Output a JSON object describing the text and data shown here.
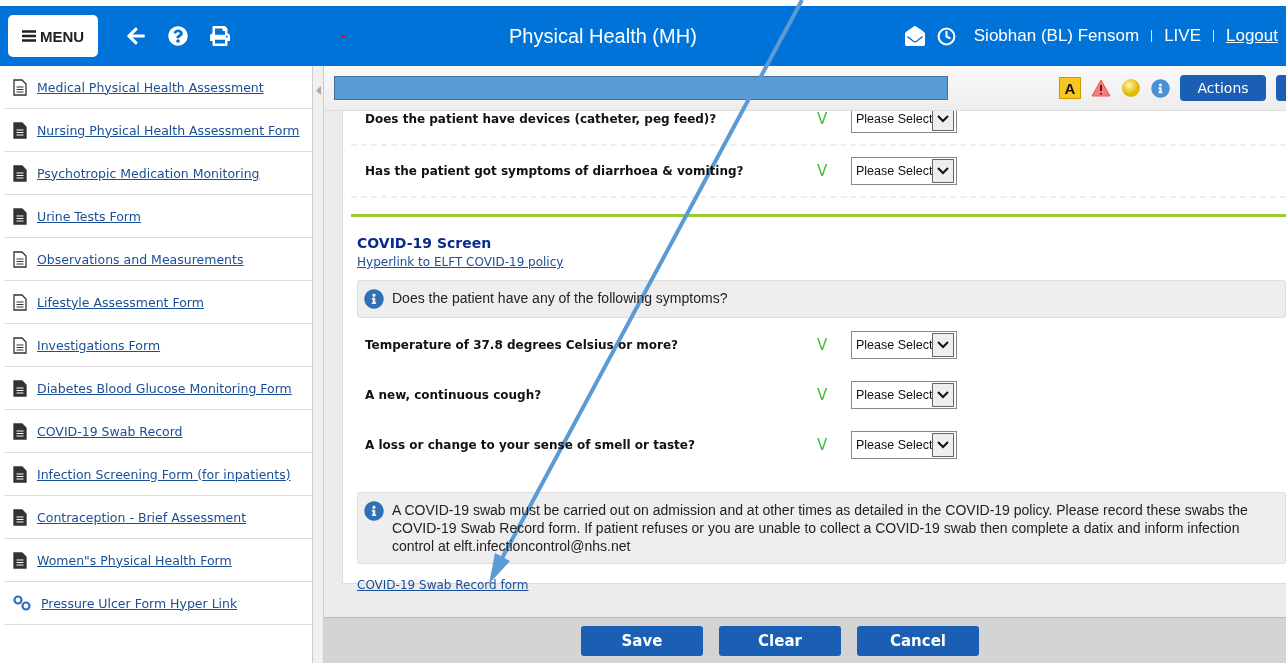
{
  "header": {
    "menu_label": "MENU",
    "title": "Physical Health (MH)",
    "user": "Siobhan (BL) Fensom",
    "environment": "LIVE",
    "logout": "Logout"
  },
  "sidebar": {
    "items": [
      {
        "label": "Medical Physical Health Assessment",
        "kind": "outline"
      },
      {
        "label": "Nursing Physical Health Assessment Form",
        "kind": "filled"
      },
      {
        "label": "Psychotropic Medication Monitoring",
        "kind": "filled"
      },
      {
        "label": "Urine Tests Form",
        "kind": "filled"
      },
      {
        "label": "Observations and Measurements",
        "kind": "outline"
      },
      {
        "label": "Lifestyle Assessment Form",
        "kind": "outline"
      },
      {
        "label": "Investigations Form",
        "kind": "outline"
      },
      {
        "label": "Diabetes Blood Glucose Monitoring Form",
        "kind": "filled"
      },
      {
        "label": "COVID-19 Swab Record",
        "kind": "filled"
      },
      {
        "label": "Infection Screening Form (for inpatients)",
        "kind": "filled"
      },
      {
        "label": "Contraception - Brief Assessment",
        "kind": "filled"
      },
      {
        "label": "Women\"s Physical Health Form",
        "kind": "filled"
      },
      {
        "label": "Pressure Ulcer Form Hyper Link",
        "kind": "link"
      }
    ]
  },
  "toolbar": {
    "badge_letter": "A",
    "actions": "Actions"
  },
  "questions": [
    {
      "text": "Does the patient have devices (catheter, peg feed)?",
      "marker": "V",
      "value": "Please Select"
    },
    {
      "text": "Has the patient got symptoms of diarrhoea & vomiting?",
      "marker": "V",
      "value": "Please Select"
    }
  ],
  "covid": {
    "title": "COVID-19 Screen",
    "policy_link": "Hyperlink to ELFT COVID-19 policy",
    "info": "Does the patient have any of the following symptoms?",
    "questions": [
      {
        "text": "Temperature of 37.8 degrees Celsius or more?",
        "marker": "V",
        "value": "Please Select"
      },
      {
        "text": "A new, continuous cough?",
        "marker": "V",
        "value": "Please Select"
      },
      {
        "text": "A loss or change to your sense of smell or taste?",
        "marker": "V",
        "value": "Please Select"
      }
    ],
    "notice": "A COVID-19 swab must be carried out on admission and at other times as detailed in the COVID-19 policy. Please record these swabs the COVID-19 Swab Record form. If patient refuses or you are unable to collect a COVID-19 swab then complete a datix and inform infection control at elft.infectioncontrol@nhs.net",
    "form_link": "COVID-19 Swab Record form"
  },
  "buttons": [
    "Save",
    "Clear",
    "Cancel"
  ]
}
